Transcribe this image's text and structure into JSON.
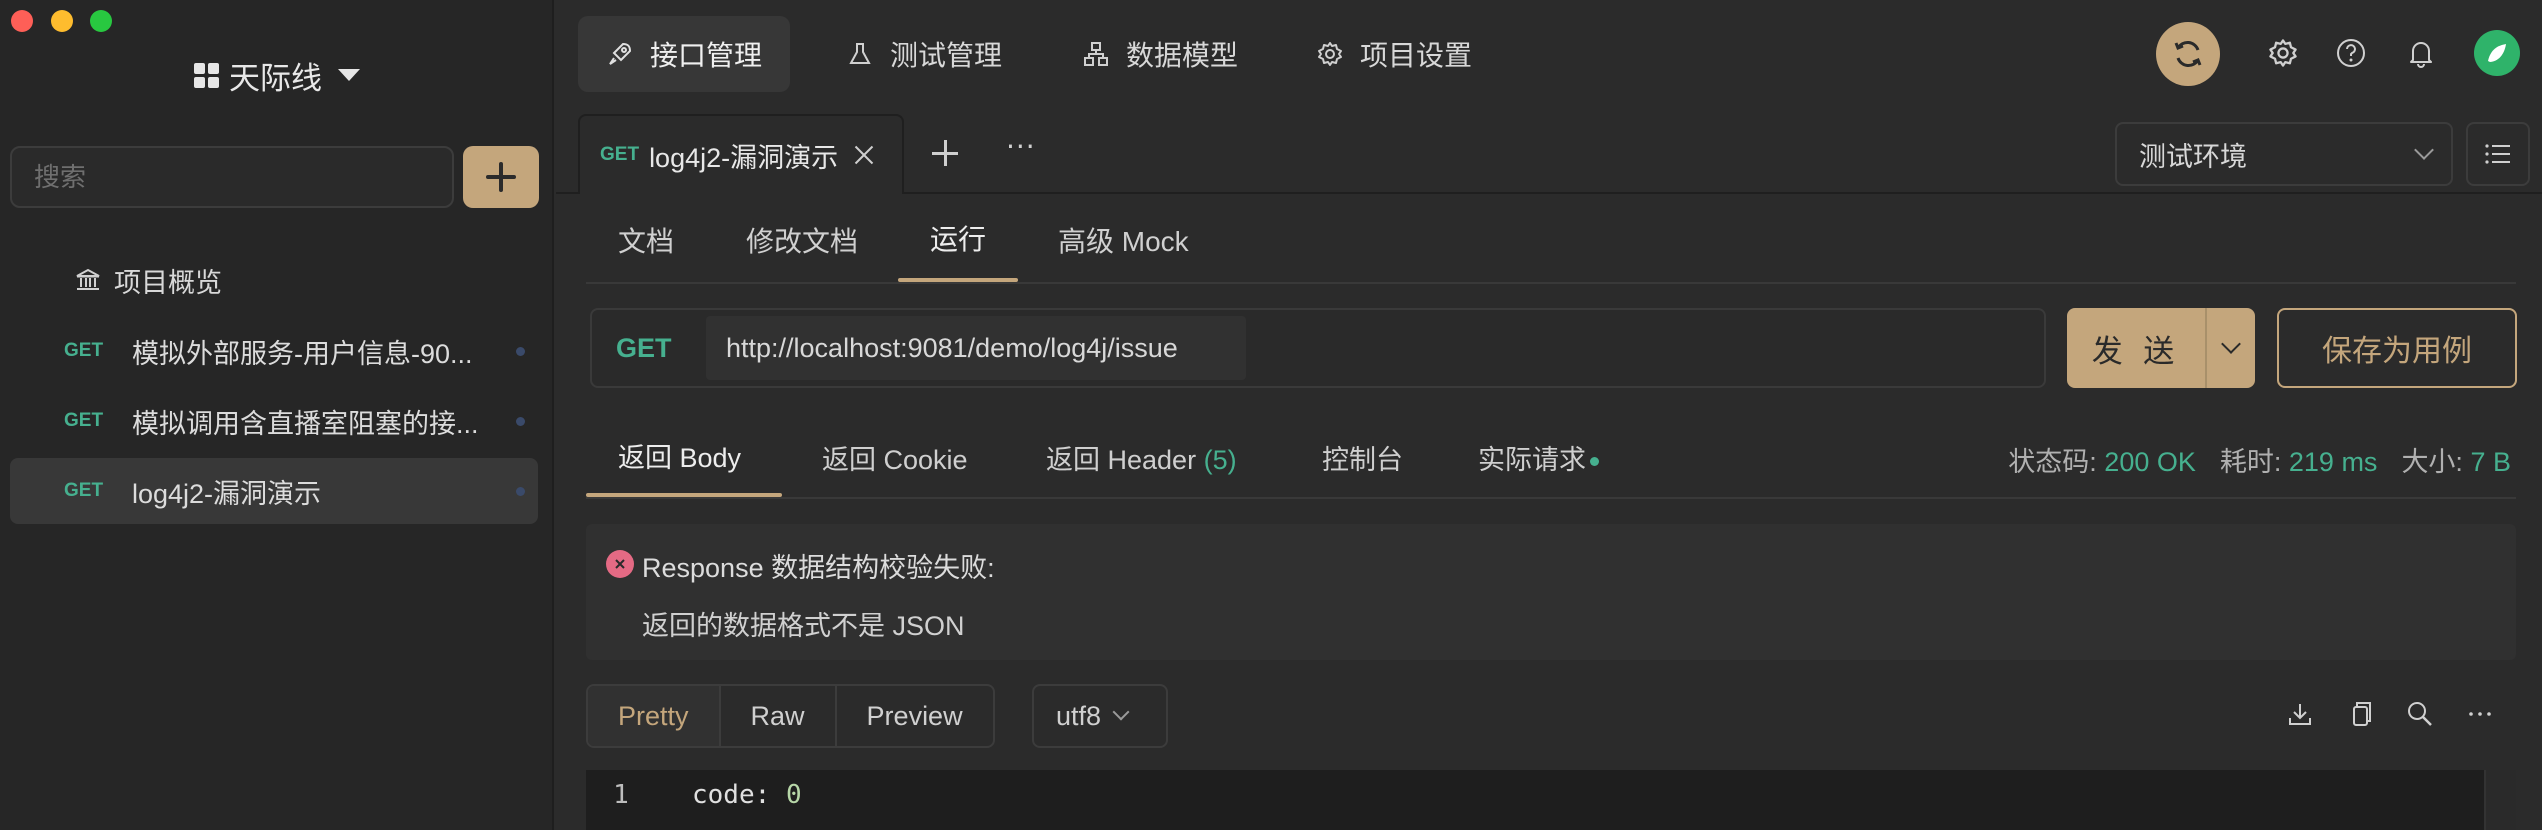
{
  "workspace": {
    "name": "天际线"
  },
  "sidebar": {
    "search_placeholder": "搜索",
    "overview_label": "项目概览",
    "items": [
      {
        "method": "GET",
        "name": "模拟外部服务-用户信息-90..."
      },
      {
        "method": "GET",
        "name": "模拟调用含直播室阻塞的接..."
      },
      {
        "method": "GET",
        "name": "log4j2-漏洞演示"
      }
    ]
  },
  "nav": {
    "tabs": [
      "接口管理",
      "测试管理",
      "数据模型",
      "项目设置"
    ]
  },
  "doc_tab": {
    "method": "GET",
    "name": "log4j2-漏洞演示",
    "more": "···"
  },
  "environment": {
    "selected": "测试环境"
  },
  "sub_tabs": [
    "文档",
    "修改文档",
    "运行",
    "高级 Mock"
  ],
  "request": {
    "method": "GET",
    "url": "http://localhost:9081/demo/log4j/issue",
    "send_label": "发 送",
    "save_case_label": "保存为用例"
  },
  "response": {
    "tabs": [
      "返回 Body",
      "返回 Cookie",
      "返回 Header",
      "控制台",
      "实际请求"
    ],
    "header_count": "(5)",
    "status_label": "状态码:",
    "status_value": "200 OK",
    "time_label": "耗时:",
    "time_value": "219 ms",
    "size_label": "大小:",
    "size_value": "7 B",
    "validation_title": "Response 数据结构校验失败:",
    "validation_detail": "返回的数据格式不是 JSON",
    "formats": [
      "Pretty",
      "Raw",
      "Preview"
    ],
    "encoding": "utf8",
    "code": {
      "line": "1",
      "key": "code:",
      "value": "0"
    }
  },
  "colors": {
    "accent": "#c4a67c",
    "method_get": "#46b08f",
    "error": "#e46a84"
  }
}
